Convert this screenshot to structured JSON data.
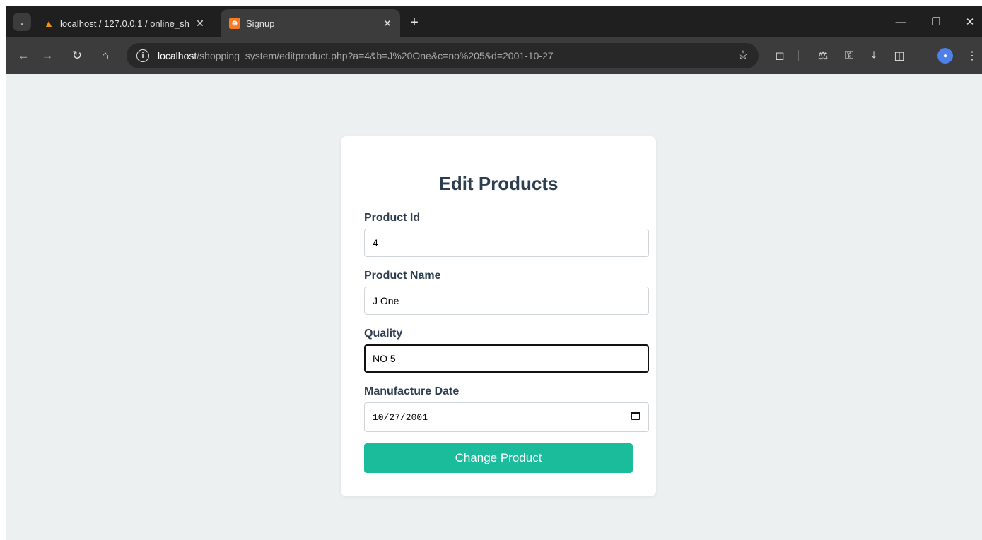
{
  "browser": {
    "tabs": [
      {
        "title": "localhost / 127.0.0.1 / online_sh",
        "active": false,
        "favicon": "phpmyadmin-icon"
      },
      {
        "title": "Signup",
        "active": true,
        "favicon": "xampp-icon"
      }
    ],
    "address": {
      "host": "localhost",
      "path": "/shopping_system/editproduct.php?a=4&b=J%20One&c=no%205&d=2001-10-27"
    }
  },
  "form": {
    "heading": "Edit Products",
    "fields": [
      {
        "label": "Product Id",
        "value": "4"
      },
      {
        "label": "Product Name",
        "value": "J One"
      },
      {
        "label": "Quality",
        "value": "NO 5"
      },
      {
        "label": "Manufacture Date",
        "value": "10/27/2001"
      }
    ],
    "submit_label": "Change Product"
  },
  "colors": {
    "page_bg": "#ecf0f1",
    "heading": "#2c3e50",
    "button": "#1abc9c"
  }
}
